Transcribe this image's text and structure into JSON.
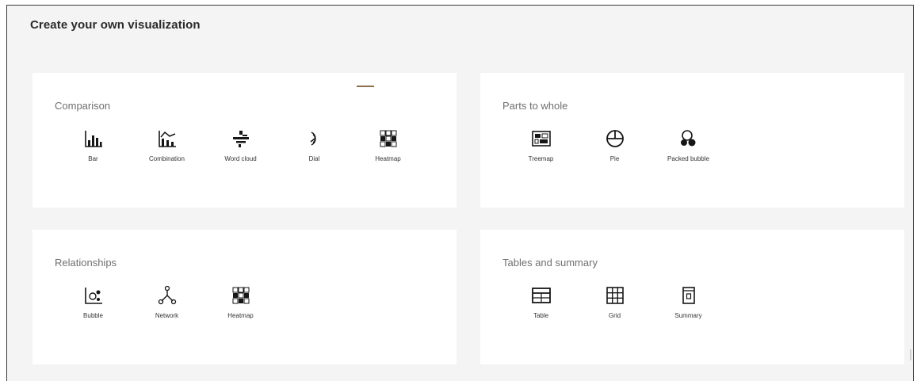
{
  "page": {
    "title": "Create your own visualization"
  },
  "sections": {
    "comparison": {
      "title": "Comparison",
      "items": [
        {
          "label": "Bar",
          "icon": "bar-chart-icon"
        },
        {
          "label": "Combination",
          "icon": "combination-chart-icon"
        },
        {
          "label": "Word cloud",
          "icon": "word-cloud-icon"
        },
        {
          "label": "Dial",
          "icon": "dial-icon"
        },
        {
          "label": "Heatmap",
          "icon": "heatmap-icon"
        }
      ]
    },
    "parts_to_whole": {
      "title": "Parts to whole",
      "items": [
        {
          "label": "Treemap",
          "icon": "treemap-icon"
        },
        {
          "label": "Pie",
          "icon": "pie-chart-icon"
        },
        {
          "label": "Packed bubble",
          "icon": "packed-bubble-icon"
        }
      ]
    },
    "relationships": {
      "title": "Relationships",
      "items": [
        {
          "label": "Bubble",
          "icon": "bubble-chart-icon"
        },
        {
          "label": "Network",
          "icon": "network-icon"
        },
        {
          "label": "Heatmap",
          "icon": "heatmap-icon"
        }
      ]
    },
    "tables_and_summary": {
      "title": "Tables and summary",
      "items": [
        {
          "label": "Table",
          "icon": "table-icon"
        },
        {
          "label": "Grid",
          "icon": "grid-icon"
        },
        {
          "label": "Summary",
          "icon": "summary-icon"
        }
      ]
    }
  },
  "colors": {
    "background": "#f4f4f4",
    "card": "#ffffff",
    "icon": "#161616",
    "section_title": "#6f6f6f"
  }
}
